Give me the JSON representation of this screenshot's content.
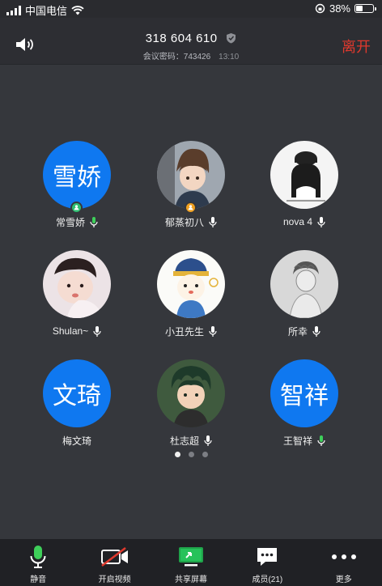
{
  "status_bar": {
    "carrier": "中国电信",
    "battery": "38%",
    "battery_level": 0.38
  },
  "header": {
    "meeting_id": "318 604 610",
    "password_label": "会议密码：743426",
    "elapsed": "13:10",
    "leave_label": "离开"
  },
  "participants": [
    {
      "name": "常雪娇",
      "avatar_text": "雪娇",
      "avatar_type": "text",
      "host_badge_color": "#2fbf71",
      "mic": "active"
    },
    {
      "name": "郁蒸初八",
      "avatar_text": "",
      "avatar_type": "image",
      "host_badge_color": "#f0a020",
      "mic": "normal"
    },
    {
      "name": "nova 4",
      "avatar_text": "",
      "avatar_type": "image",
      "host_badge_color": "",
      "mic": "normal"
    },
    {
      "name": "Shulan~",
      "avatar_text": "",
      "avatar_type": "image",
      "host_badge_color": "",
      "mic": "normal"
    },
    {
      "name": "小丑先生",
      "avatar_text": "",
      "avatar_type": "image",
      "host_badge_color": "",
      "mic": "normal"
    },
    {
      "name": "所幸",
      "avatar_text": "",
      "avatar_type": "image",
      "host_badge_color": "",
      "mic": "normal"
    },
    {
      "name": "梅文琦",
      "avatar_text": "文琦",
      "avatar_type": "text",
      "host_badge_color": "",
      "mic": "none"
    },
    {
      "name": "杜志超",
      "avatar_text": "",
      "avatar_type": "image",
      "host_badge_color": "",
      "mic": "normal"
    },
    {
      "name": "王智祥",
      "avatar_text": "智祥",
      "avatar_type": "text",
      "host_badge_color": "",
      "mic": "active"
    }
  ],
  "pagination": {
    "pages": 3,
    "current": 1
  },
  "toolbar": {
    "mute_label": "静音",
    "video_label": "开启视频",
    "share_label": "共享屏幕",
    "members_label": "成员(21)",
    "more_label": "更多"
  },
  "colors": {
    "background": "#35373c",
    "accent_blue": "#0f78f0",
    "leave_red": "#e0392d",
    "mic_green": "#3ecf5a"
  }
}
